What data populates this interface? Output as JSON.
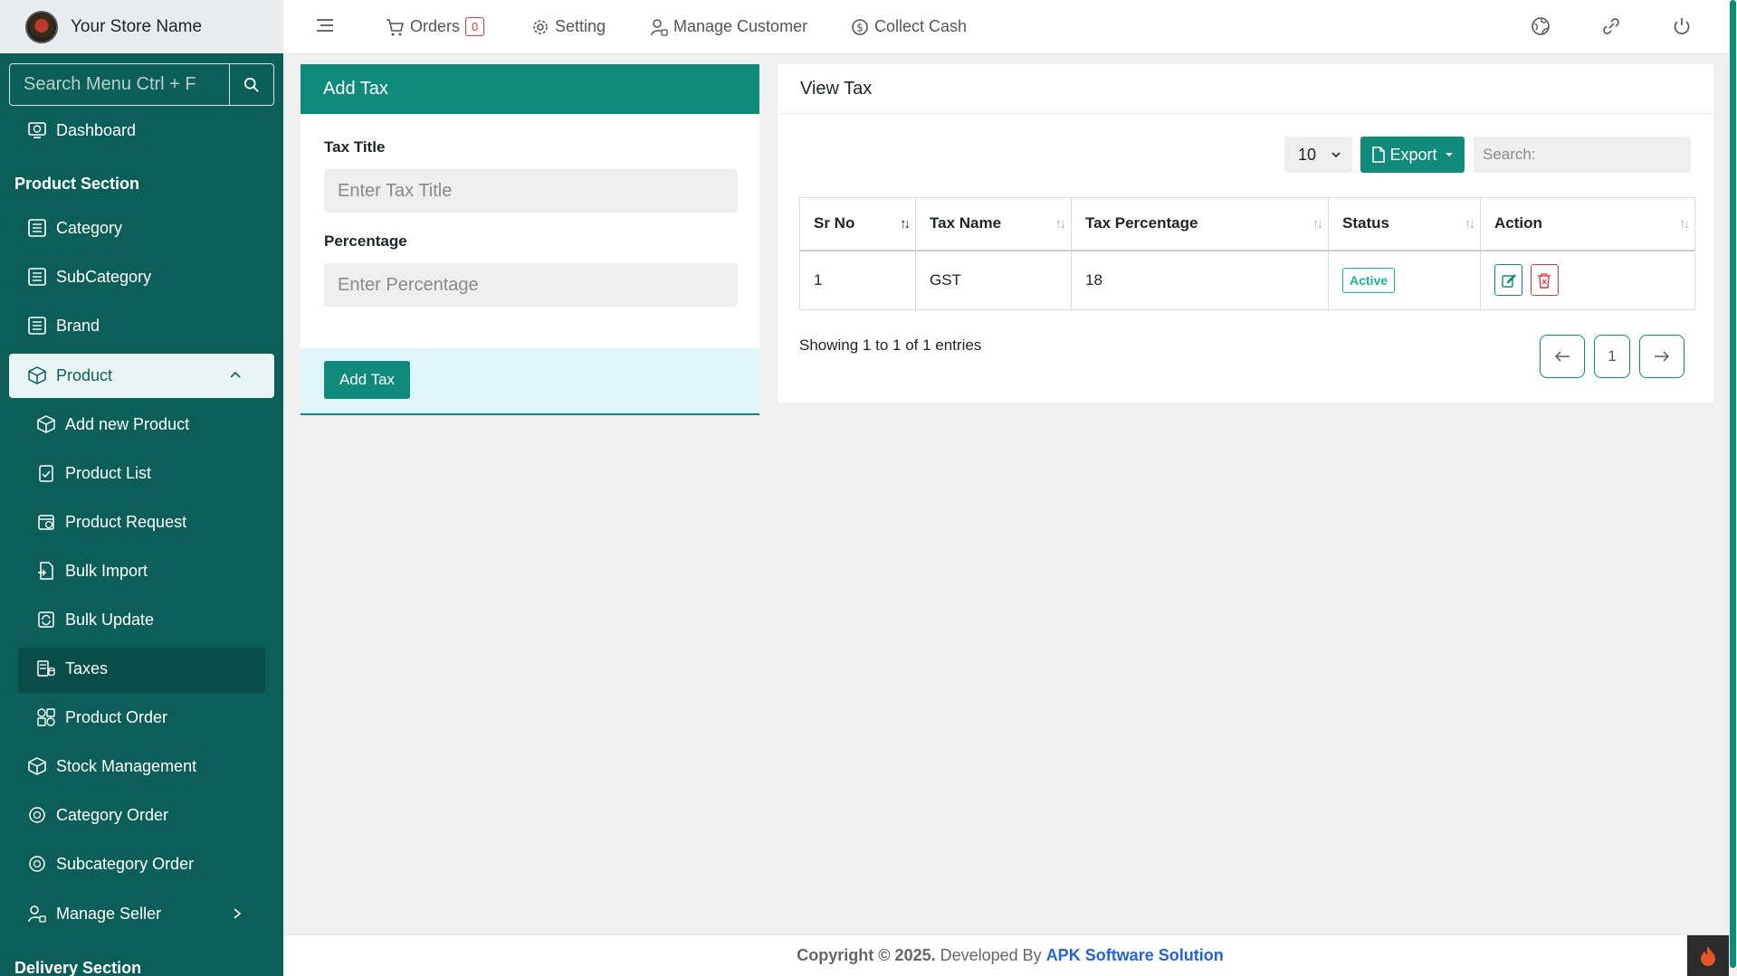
{
  "store_name": "Your Store Name",
  "sidebar": {
    "search_placeholder": "Search Menu Ctrl + F",
    "dashboard": "Dashboard",
    "product_section": "Product Section",
    "category": "Category",
    "subcategory": "SubCategory",
    "brand": "Brand",
    "product": "Product",
    "add_new_product": "Add new Product",
    "product_list": "Product List",
    "product_request": "Product Request",
    "bulk_import": "Bulk Import",
    "bulk_update": "Bulk Update",
    "taxes": "Taxes",
    "product_order": "Product Order",
    "stock_management": "Stock Management",
    "category_order": "Category Order",
    "subcategory_order": "Subcategory Order",
    "manage_seller": "Manage Seller",
    "delivery_section": "Delivery Section"
  },
  "topbar": {
    "orders": "Orders",
    "orders_count": "0",
    "setting": "Setting",
    "manage_customer": "Manage Customer",
    "collect_cash": "Collect Cash"
  },
  "add_tax": {
    "title": "Add Tax",
    "tax_title_label": "Tax Title",
    "tax_title_placeholder": "Enter Tax Title",
    "percentage_label": "Percentage",
    "percentage_placeholder": "Enter Percentage",
    "button": "Add Tax"
  },
  "view_tax": {
    "title": "View Tax",
    "per_page": "10",
    "export": "Export",
    "search_placeholder": "Search:",
    "columns": [
      "Sr No",
      "Tax Name",
      "Tax Percentage",
      "Status",
      "Action"
    ],
    "rows": [
      {
        "sr": "1",
        "name": "GST",
        "percentage": "18",
        "status": "Active"
      }
    ],
    "showing": "Showing 1 to 1 of 1 entries",
    "page": "1"
  },
  "footer": {
    "copyright": "Copyright © 2025.",
    "developed_by": "Developed By",
    "company": "APK Software Solution"
  },
  "colors": {
    "sidebar": "#0c5f59",
    "accent": "#0f8a7b",
    "danger": "#dc3545",
    "link": "#2563d8"
  }
}
